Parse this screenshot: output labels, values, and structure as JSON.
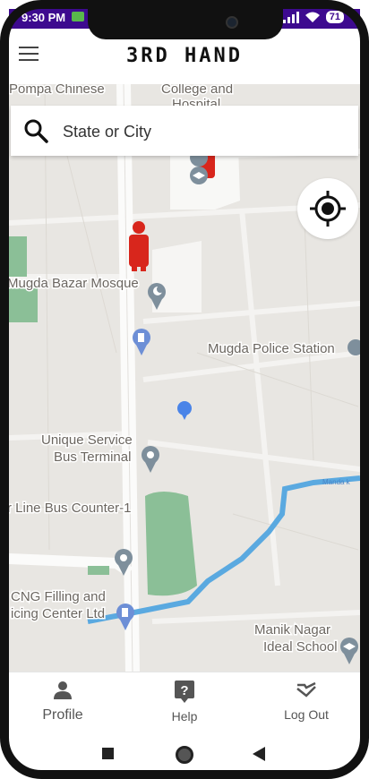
{
  "status_bar": {
    "time": "9:30 PM",
    "battery": "71"
  },
  "app": {
    "title": "3RD HAND"
  },
  "search": {
    "placeholder": "State or City"
  },
  "map": {
    "labels": {
      "college": "College and",
      "college2": "Hospital",
      "partial_top": "Pompa Chinese",
      "mosque": "Mugda Bazar Mosque",
      "police": "Mugda Police Station",
      "bus_terminal1": "Unique Service",
      "bus_terminal2": "Bus Terminal",
      "bus_counter": "r Line Bus Counter-1",
      "cng1": "CNG Filling and",
      "cng2": "icing Center Ltd",
      "school1": "Manik Nagar",
      "school2": "Ideal School",
      "canal": "Manda k"
    }
  },
  "bottom_nav": {
    "profile": "Profile",
    "help": "Help",
    "logout": "Log Out"
  },
  "colors": {
    "status_bar": "#3d0a8f",
    "marker_red": "#d8261c",
    "park_green": "#8bbf97",
    "water_blue": "#5aa9e0"
  }
}
